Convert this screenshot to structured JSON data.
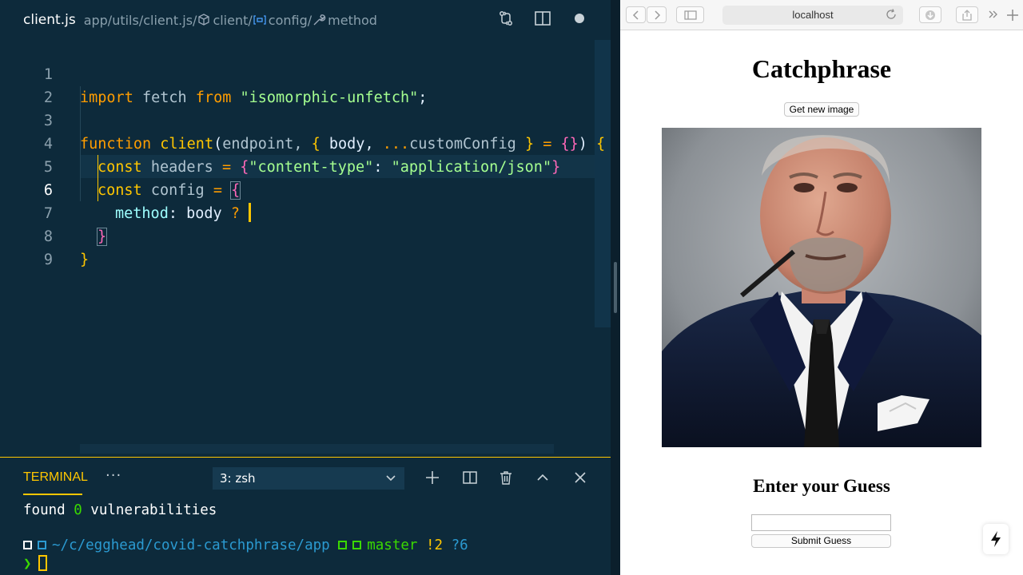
{
  "editor": {
    "file_name": "client.js",
    "breadcrumb": {
      "path": "app/utils/client.js/",
      "symbol_client": "client/",
      "symbol_config": "config/",
      "symbol_method": "method"
    },
    "line_numbers": [
      "1",
      "2",
      "3",
      "4",
      "5",
      "6",
      "7",
      "8",
      "9"
    ],
    "code": {
      "l1": {
        "kw": "import",
        "mid": " fetch ",
        "kw2": "from",
        "str": "\"isomorphic-unfetch\"",
        "end": ";"
      },
      "l3": {
        "kw": "function",
        "fn": "client",
        "open": "(",
        "param": "endpoint, ",
        "b1": "{",
        "body": " body, ",
        "spread": "...",
        "rest": "customConfig ",
        "b2": "}",
        "eq": " = ",
        "obj": "{}",
        "close": ")",
        "b3": " {"
      },
      "l4": {
        "kw": "const",
        "name": " headers ",
        "eq": "= ",
        "b1": "{",
        "key": "\"content-type\"",
        "colon": ": ",
        "val": "\"application/json\"",
        "b2": "}"
      },
      "l5": {
        "kw": "const",
        "name": " config ",
        "eq": "= ",
        "b1": "{"
      },
      "l6": {
        "prop": "method",
        "colon": ": ",
        "val": "body ",
        "q": "?"
      },
      "l7": {
        "b": "}"
      },
      "l8": {
        "b": "}"
      }
    },
    "icons": [
      "git-compare-icon",
      "split-editor-icon",
      "dirty-dot"
    ]
  },
  "terminal": {
    "tab_label": "TERMINAL",
    "more": "···",
    "selected_shell": "3: zsh",
    "line1": {
      "a": "found ",
      "n": "0",
      "b": " vulnerabilities"
    },
    "line2": {
      "path": "~/c/egghead/covid-catchphrase/app",
      "branch": "master",
      "mod": "!2",
      "untracked": "?6"
    },
    "prompt": "❯"
  },
  "browser": {
    "url": "localhost",
    "page": {
      "title": "Catchphrase",
      "get_image_label": "Get new image",
      "guess_title": "Enter your Guess",
      "guess_value": "",
      "submit_label": "Submit Guess"
    }
  },
  "colors": {
    "editor_bg": "#0d2a3b",
    "accent": "#ffc600",
    "string": "#a5ff90",
    "keyword": "#ff9d00",
    "bracket": "#ff68b8"
  }
}
